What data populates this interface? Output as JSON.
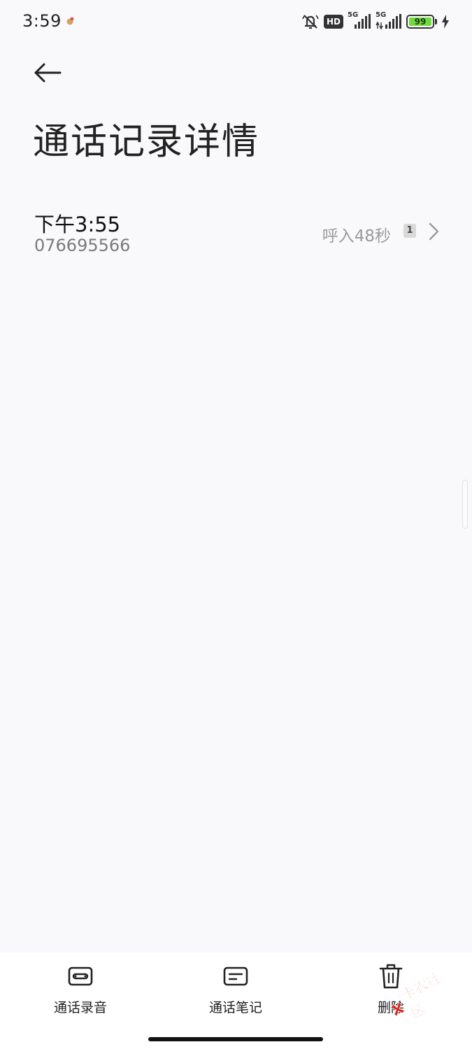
{
  "status_bar": {
    "time": "3:59",
    "hd_label": "HD",
    "net1": "5G",
    "net2": "5G",
    "battery": "99",
    "battery_level": 0.99,
    "colors": {
      "battery_fill": "#6edb3e"
    }
  },
  "header": {
    "back_icon": "arrow-left-icon",
    "title": "通话记录详情"
  },
  "call_record": {
    "time": "下午3:55",
    "number": "076695566",
    "type_duration": "呼入48秒",
    "sim": "1",
    "chevron_icon": "chevron-right-icon"
  },
  "bottom_bar": {
    "record": {
      "label": "通话录音",
      "icon": "cassette-icon"
    },
    "notes": {
      "label": "通话笔记",
      "icon": "note-icon"
    },
    "delete": {
      "label": "删除",
      "icon": "trash-icon"
    }
  },
  "watermark": {
    "text": "卡农社区",
    "icon": "watermark-logo-icon",
    "color": "#d8261f"
  }
}
